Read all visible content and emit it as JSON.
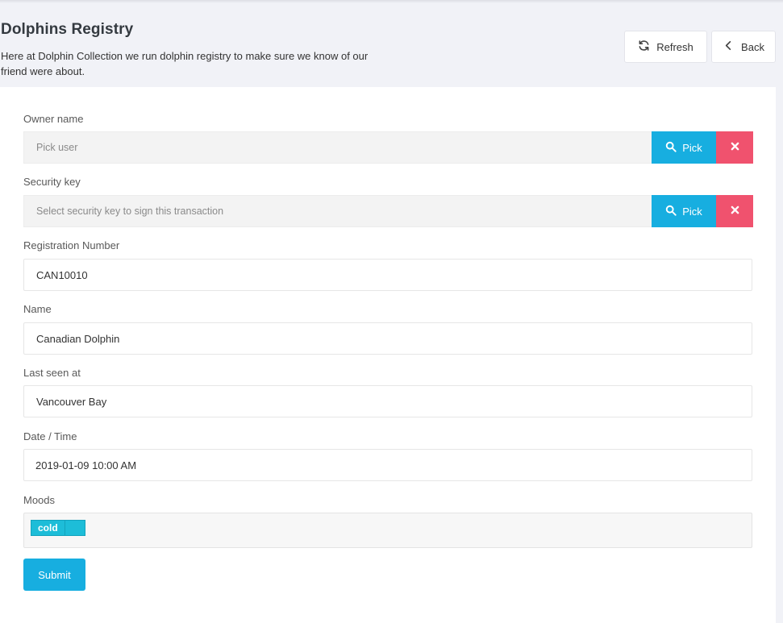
{
  "header": {
    "title": "Dolphins Registry",
    "description": "Here at Dolphin Collection we run dolphin registry to make sure we know of our friend were about.",
    "refresh_label": "Refresh",
    "back_label": "Back"
  },
  "form": {
    "owner": {
      "label": "Owner name",
      "placeholder": "Pick user",
      "pick_label": "Pick"
    },
    "security_key": {
      "label": "Security key",
      "placeholder": "Select security key to sign this transaction",
      "pick_label": "Pick"
    },
    "registration_number": {
      "label": "Registration Number",
      "value": "CAN10010"
    },
    "name": {
      "label": "Name",
      "value": "Canadian Dolphin"
    },
    "last_seen": {
      "label": "Last seen at",
      "value": "Vancouver Bay"
    },
    "datetime": {
      "label": "Date / Time",
      "value": "2019-01-09 10:00 AM"
    },
    "moods": {
      "label": "Moods",
      "tags": [
        "cold"
      ]
    },
    "submit_label": "Submit"
  },
  "colors": {
    "primary": "#17aee0",
    "danger": "#f0526e",
    "tag": "#1dbdd8"
  }
}
